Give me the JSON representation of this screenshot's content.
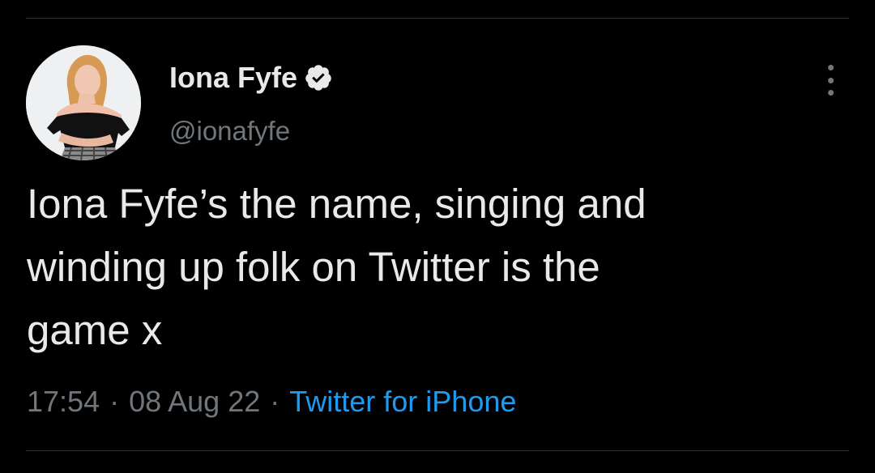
{
  "tweet": {
    "author": {
      "display_name": "Iona Fyfe",
      "handle": "@ionafyfe",
      "verified": true,
      "verified_icon": "verified-badge-icon",
      "avatar": "profile-photo"
    },
    "text_lines": [
      "Iona Fyfe’s the name, singing and",
      "winding up folk on Twitter is the",
      "game x"
    ],
    "meta": {
      "time": "17:54",
      "date": "08 Aug 22",
      "separator": "·",
      "source": "Twitter for iPhone"
    },
    "more_icon": "more-options-icon"
  },
  "colors": {
    "background": "#000000",
    "primary_text": "#e7e9ea",
    "secondary_text": "#71767b",
    "link": "#1d9bf0",
    "divider": "#2f3336",
    "verified_badge": "#e7e9ea"
  }
}
